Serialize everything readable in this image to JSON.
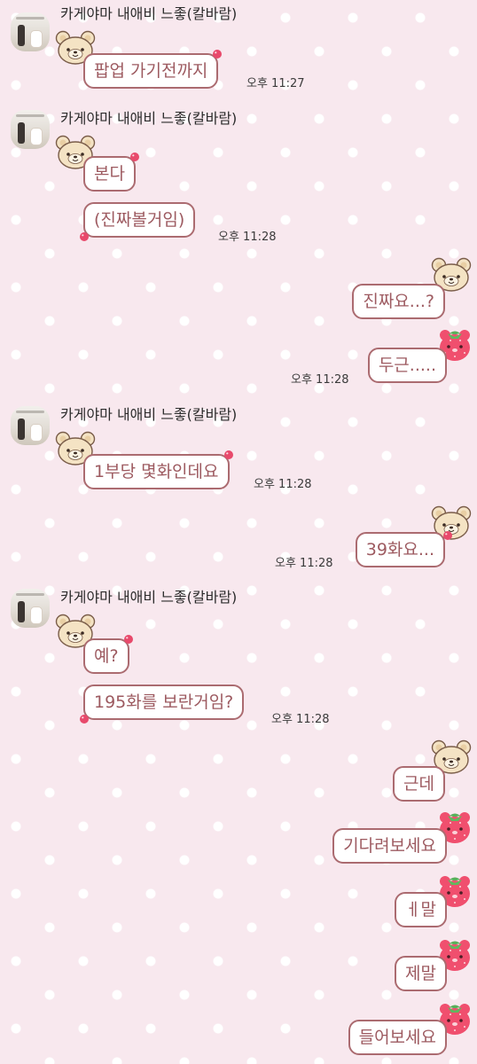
{
  "chat": {
    "sender_name": "카게야마 내애비 느좋(칼바람)",
    "blocks": [
      {
        "sender": "카게야마 내애비 느좋(칼바람)",
        "messages": [
          "팝업 가기전까지"
        ],
        "time": "오후 11:27"
      },
      {
        "sender": "카게야마 내애비 느좋(칼바람)",
        "messages": [
          "본다",
          "(진짜볼거임)"
        ],
        "time": "오후 11:28"
      },
      {
        "sender": "me",
        "messages": [
          "진짜요...?",
          "두근....."
        ],
        "time": "오후 11:28"
      },
      {
        "sender": "카게야마 내애비 느좋(칼바람)",
        "messages": [
          "1부당 몇화인데요"
        ],
        "time": "오후 11:28"
      },
      {
        "sender": "me",
        "messages": [
          "39화요..."
        ],
        "time": "오후 11:28"
      },
      {
        "sender": "카게야마 내애비 느좋(칼바람)",
        "messages": [
          "예?",
          "195화를 보란거임?"
        ],
        "time": "오후 11:28"
      },
      {
        "sender": "me",
        "messages": [
          "근데",
          "기다려보세요",
          "ㅔ말",
          "제말",
          "들어보세요"
        ],
        "time": ""
      }
    ]
  },
  "icons": {
    "avatar": "profile-photo",
    "received_decoration": "bear-head-icon",
    "sent_decoration_first": "bear-head-icon",
    "sent_decoration_rest": "strawberry-icon"
  },
  "colors": {
    "background": "#f8e8ee",
    "bubble_border": "#ab6b70",
    "bubble_text": "#9d5a60",
    "accent_pink": "#e8496b"
  }
}
